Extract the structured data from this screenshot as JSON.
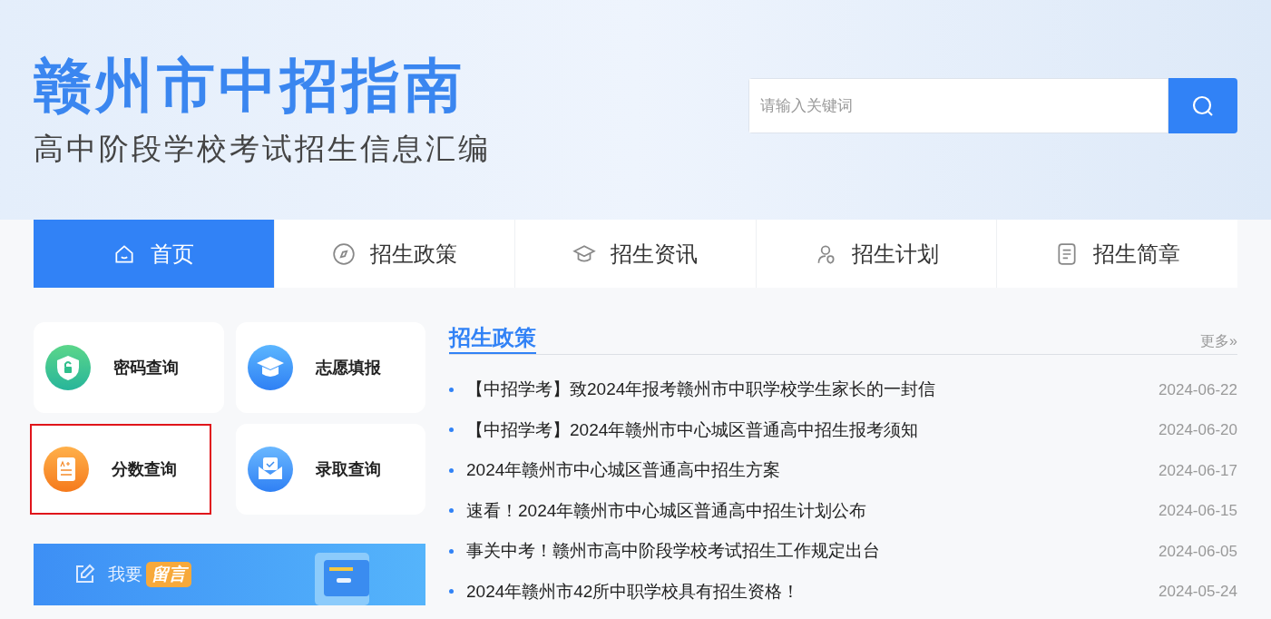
{
  "header": {
    "title": "赣州市中招指南",
    "subtitle": "高中阶段学校考试招生信息汇编",
    "search": {
      "placeholder": "请输入关键词"
    }
  },
  "nav": [
    {
      "label": "首页",
      "kind": "home",
      "selected": true
    },
    {
      "label": "招生政策",
      "kind": "compass",
      "selected": false
    },
    {
      "label": "招生资讯",
      "kind": "cap",
      "selected": false
    },
    {
      "label": "招生计划",
      "kind": "people",
      "selected": false
    },
    {
      "label": "招生简章",
      "kind": "doc",
      "selected": false
    }
  ],
  "quick_links": [
    {
      "label": "密码查询",
      "kind": "shield",
      "highlighted": false
    },
    {
      "label": "志愿填报",
      "kind": "cap",
      "highlighted": false
    },
    {
      "label": "分数查询",
      "kind": "score",
      "highlighted": true
    },
    {
      "label": "录取查询",
      "kind": "mail",
      "highlighted": false
    }
  ],
  "message_banner": {
    "text": "我要",
    "badge": "留言"
  },
  "news": {
    "title": "招生政策",
    "more": "更多»",
    "items": [
      {
        "title": "【中招学考】致2024年报考赣州市中职学校学生家长的一封信",
        "date": "2024-06-22"
      },
      {
        "title": "【中招学考】2024年赣州市中心城区普通高中招生报考须知",
        "date": "2024-06-20"
      },
      {
        "title": "2024年赣州市中心城区普通高中招生方案",
        "date": "2024-06-17"
      },
      {
        "title": "速看！2024年赣州市中心城区普通高中招生计划公布",
        "date": "2024-06-15"
      },
      {
        "title": "事关中考！赣州市高中阶段学校考试招生工作规定出台",
        "date": "2024-06-05"
      },
      {
        "title": "2024年赣州市42所中职学校具有招生资格！",
        "date": "2024-05-24"
      }
    ]
  }
}
